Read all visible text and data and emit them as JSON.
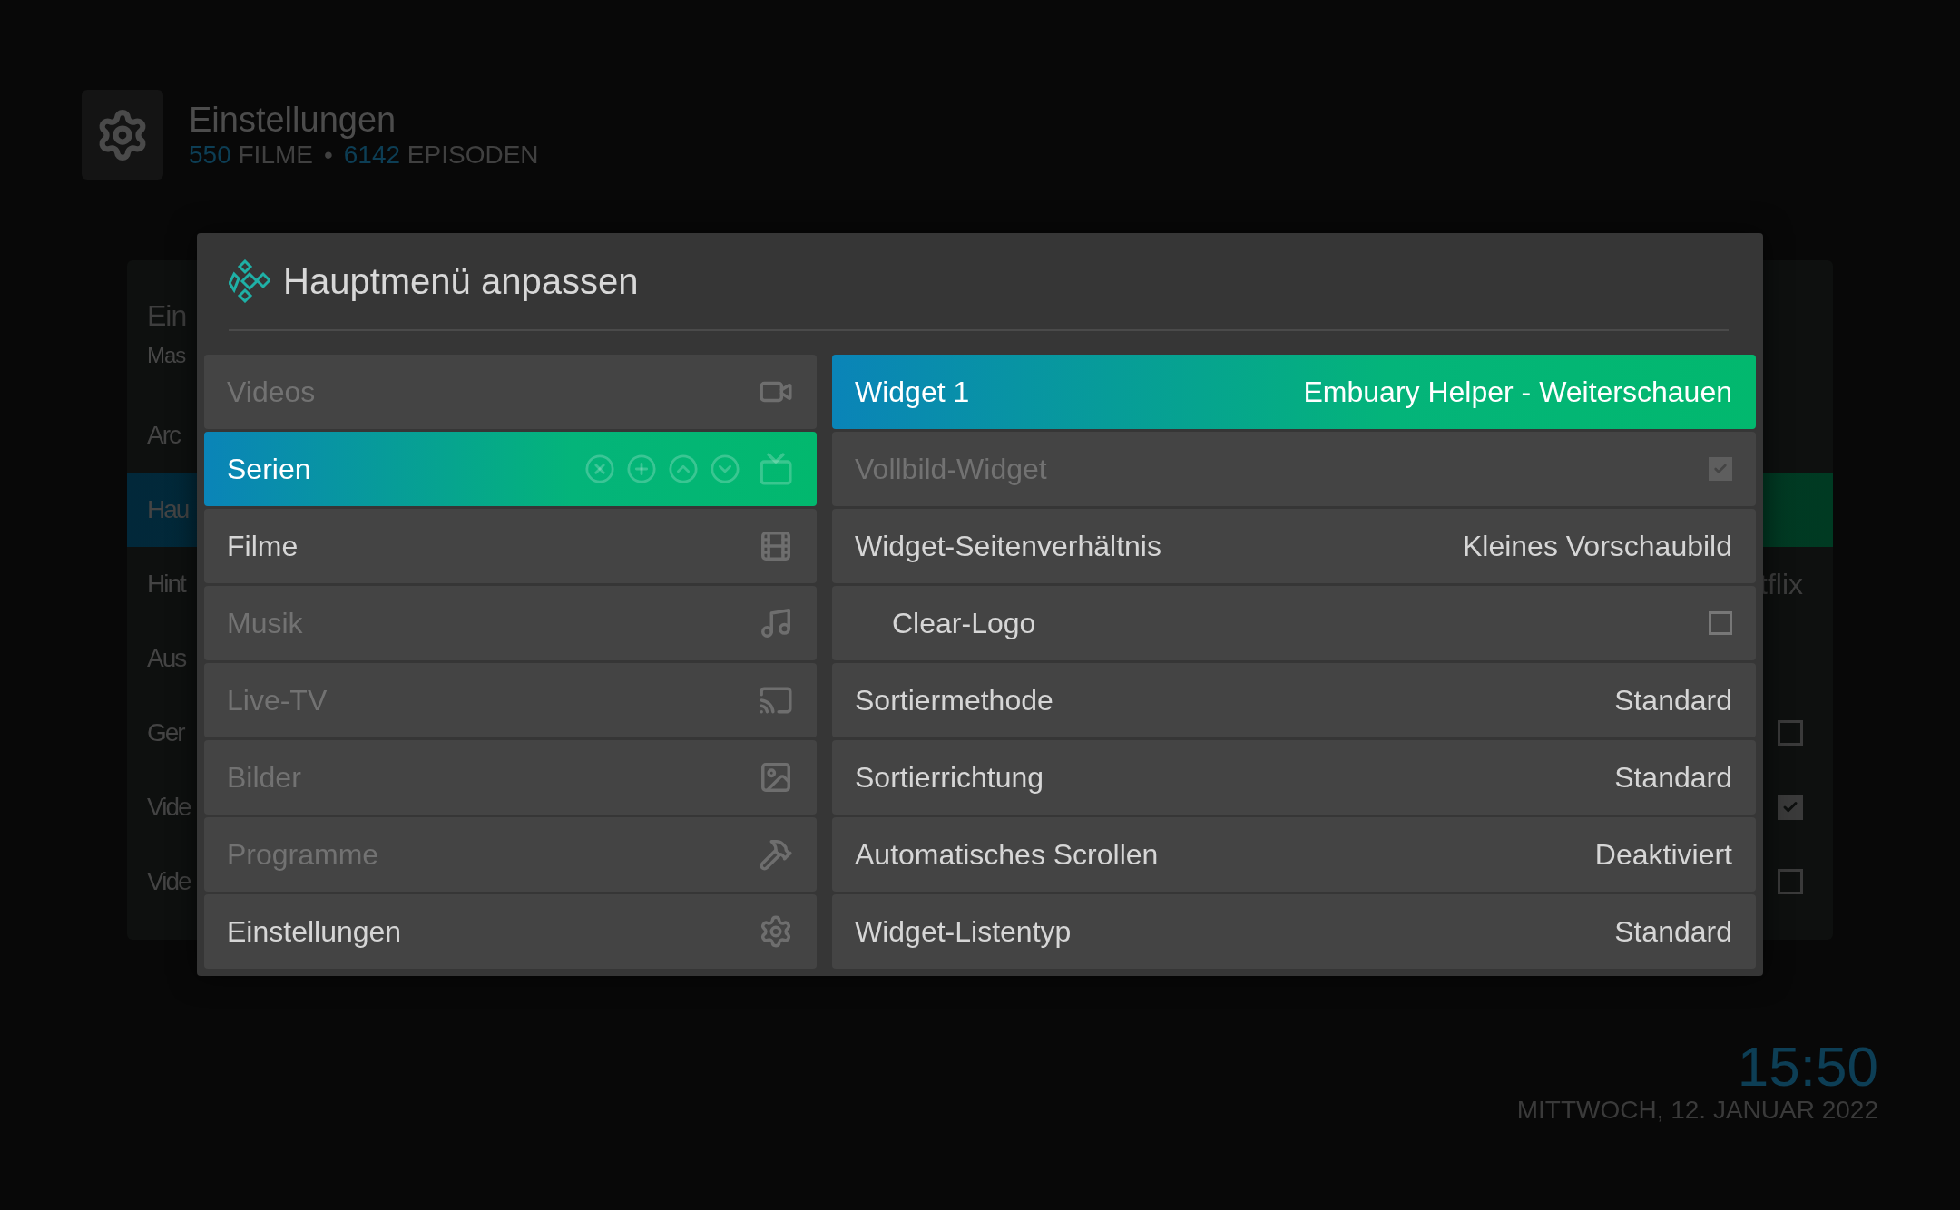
{
  "header": {
    "title": "Einstellungen",
    "stats": [
      {
        "count": "550",
        "label": "FILME"
      },
      {
        "count": "6142",
        "label": "EPISODEN"
      }
    ],
    "separator": "•"
  },
  "background_panel": {
    "title": "Ein",
    "subtitle": "Mas",
    "rows": [
      {
        "label": "Arc",
        "kind": "text",
        "selected": false
      },
      {
        "label": "Hau",
        "kind": "text",
        "selected": true
      },
      {
        "label": "Hint",
        "kind": "value",
        "value": "tflix",
        "selected": false
      },
      {
        "label": "Aus",
        "kind": "text",
        "selected": false
      },
      {
        "label": "Ger",
        "kind": "checkbox",
        "checked": false,
        "selected": false
      },
      {
        "label": "Vide",
        "kind": "checkbox",
        "checked": true,
        "selected": false
      },
      {
        "label": "Vide",
        "kind": "checkbox",
        "checked": false,
        "selected": false
      }
    ]
  },
  "dialog": {
    "title": "Hauptmenü anpassen",
    "menu_items": [
      {
        "label": "Videos",
        "selected": false,
        "disabled": true
      },
      {
        "label": "Serien",
        "selected": true,
        "disabled": false
      },
      {
        "label": "Filme",
        "selected": false,
        "disabled": false
      },
      {
        "label": "Musik",
        "selected": false,
        "disabled": true
      },
      {
        "label": "Live-TV",
        "selected": false,
        "disabled": true
      },
      {
        "label": "Bilder",
        "selected": false,
        "disabled": true
      },
      {
        "label": "Programme",
        "selected": false,
        "disabled": true
      },
      {
        "label": "Einstellungen",
        "selected": false,
        "disabled": false
      }
    ],
    "settings": [
      {
        "label": "Widget 1",
        "kind": "value",
        "value": "Embuary Helper - Weiterschauen",
        "selected": true,
        "disabled": false
      },
      {
        "label": "Vollbild-Widget",
        "kind": "checkbox",
        "checked": true,
        "selected": false,
        "disabled": true
      },
      {
        "label": "Widget-Seitenverhältnis",
        "kind": "value",
        "value": "Kleines Vorschaubild",
        "selected": false,
        "disabled": false,
        "children": [
          {
            "label": "Clear-Logo",
            "kind": "checkbox",
            "checked": false,
            "selected": false,
            "disabled": false
          }
        ]
      },
      {
        "label": "Sortiermethode",
        "kind": "value",
        "value": "Standard",
        "selected": false,
        "disabled": false
      },
      {
        "label": "Sortierrichtung",
        "kind": "value",
        "value": "Standard",
        "selected": false,
        "disabled": false
      },
      {
        "label": "Automatisches Scrollen",
        "kind": "value",
        "value": "Deaktiviert",
        "selected": false,
        "disabled": false
      },
      {
        "label": "Widget-Listentyp",
        "kind": "value",
        "value": "Standard",
        "selected": false,
        "disabled": false
      }
    ]
  },
  "clock": {
    "time": "15:50",
    "date": "MITTWOCH, 12. JANUAR 2022"
  }
}
